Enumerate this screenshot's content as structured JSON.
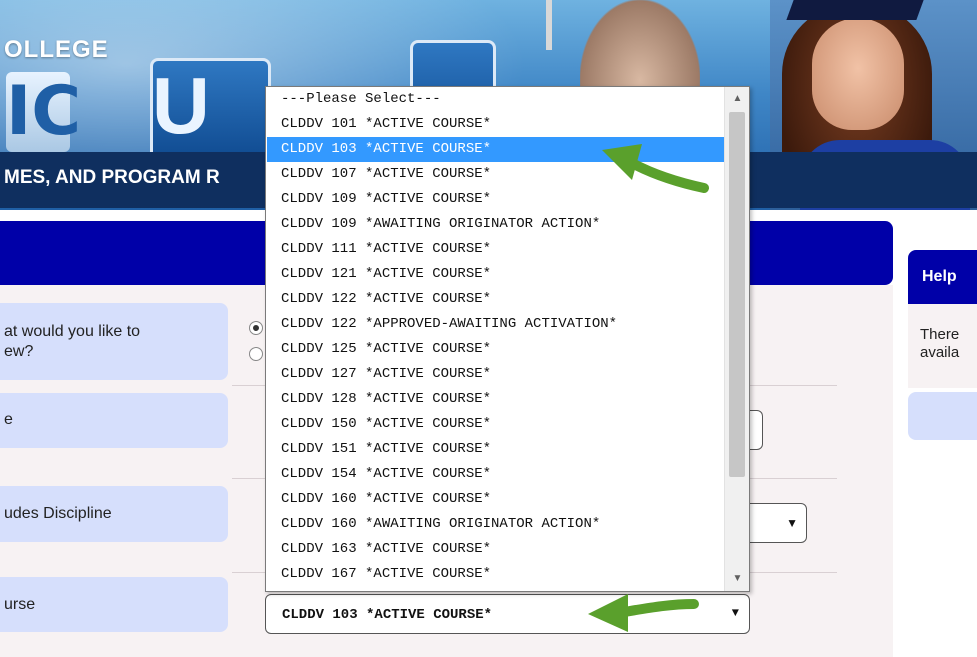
{
  "header": {
    "college": "OLLEGE",
    "logo_part1": "IC",
    "logo_part2": "U",
    "tagline": "MES, AND PROGRAM R"
  },
  "form": {
    "q1_label_line1": "at would you like to",
    "q1_label_line2": "ew?",
    "q2_label": "e",
    "q3_label": "udes Discipline",
    "q4_label": "urse"
  },
  "course_select": {
    "selected_value": "CLDDV 103 *ACTIVE COURSE*",
    "arrow": "▼",
    "options": [
      "---Please Select---",
      "CLDDV 101 *ACTIVE COURSE*",
      "CLDDV 103 *ACTIVE COURSE*",
      "CLDDV 107 *ACTIVE COURSE*",
      "CLDDV 109 *ACTIVE COURSE*",
      "CLDDV 109 *AWAITING ORIGINATOR ACTION*",
      "CLDDV 111 *ACTIVE COURSE*",
      "CLDDV 121 *ACTIVE COURSE*",
      "CLDDV 122 *ACTIVE COURSE*",
      "CLDDV 122 *APPROVED-AWAITING ACTIVATION*",
      "CLDDV 125 *ACTIVE COURSE*",
      "CLDDV 127 *ACTIVE COURSE*",
      "CLDDV 128 *ACTIVE COURSE*",
      "CLDDV 150 *ACTIVE COURSE*",
      "CLDDV 151 *ACTIVE COURSE*",
      "CLDDV 154 *ACTIVE COURSE*",
      "CLDDV 160 *ACTIVE COURSE*",
      "CLDDV 160 *AWAITING ORIGINATOR ACTION*",
      "CLDDV 163 *ACTIVE COURSE*",
      "CLDDV 167 *ACTIVE COURSE*"
    ],
    "highlighted_index": 2
  },
  "help": {
    "title": "Help",
    "body_line1": "There",
    "body_line2": "availa"
  },
  "colors": {
    "navy": "#0000a8",
    "label_bg": "#d6dffc",
    "highlight": "#3399ff",
    "annotation_arrow": "#5aa02c"
  },
  "icons": {
    "up": "▲",
    "down": "▼"
  }
}
